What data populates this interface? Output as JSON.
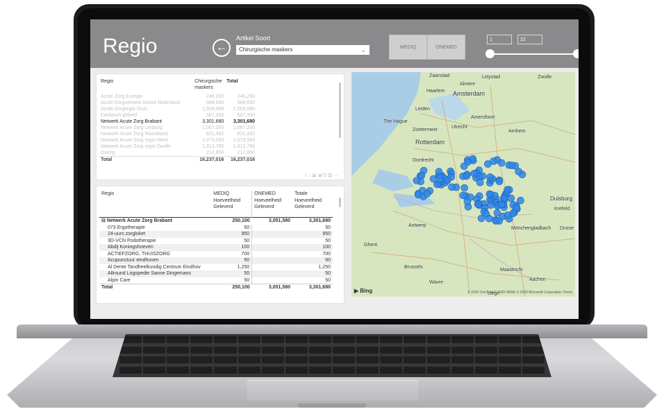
{
  "report": {
    "title": "Regio",
    "slicer_label": "Artikel Soort",
    "slicer_value": "Chirurgische maskers",
    "segments": [
      "MEDIQ",
      "ONEMED"
    ],
    "range_min": "1",
    "range_max": "22"
  },
  "table1": {
    "headers": [
      "Regio",
      "Chirurgische maskers",
      "Total"
    ],
    "rows": [
      {
        "name": "Acute Zorg Euregio",
        "a": "246,200",
        "b": "246,200",
        "state": "faded"
      },
      {
        "name": "Acute Zorgnetwerk Noord Nederland",
        "a": "968,650",
        "b": "968,650",
        "state": "faded"
      },
      {
        "name": "Acute Zorgregio Oost",
        "a": "1,559,080",
        "b": "1,559,080",
        "state": "faded"
      },
      {
        "name": "Caribisch gebied",
        "a": "507,350",
        "b": "507,350",
        "state": "faded"
      },
      {
        "name": "Netwerk Acute Zorg Brabant",
        "a": "3,301,680",
        "b": "3,301,680",
        "state": "hl"
      },
      {
        "name": "Netwerk Acute Zorg Limburg",
        "a": "1,067,200",
        "b": "1,067,200",
        "state": "faded"
      },
      {
        "name": "Netwerk Acute Zorg Noordwest",
        "a": "621,492",
        "b": "621,492",
        "state": "faded"
      },
      {
        "name": "Netwerk Acute Zorg regio West",
        "a": "1,073,583",
        "b": "1,073,583",
        "state": "faded"
      },
      {
        "name": "Netwerk Acute Zorg regio Zwolle",
        "a": "1,313,785",
        "b": "1,313,785",
        "state": "faded"
      },
      {
        "name": "Overig",
        "a": "212,850",
        "b": "212,850",
        "state": "faded"
      }
    ],
    "total_label": "Total",
    "total_a": "16,237,016",
    "total_b": "16,237,016"
  },
  "table2": {
    "headers": [
      "Regio",
      "MEDIQ Hoeveelheid Geleverd",
      "ONEMED Hoeveelheid Geleverd",
      "Totale Hoeveelheid Geleverd"
    ],
    "group": {
      "name": "Netwerk Acute Zorg Brabant",
      "m": "250,100",
      "o": "3,051,580",
      "t": "3,301,680"
    },
    "rows": [
      {
        "name": "073 Ergotherapie",
        "m": "50",
        "o": "",
        "t": "50"
      },
      {
        "name": "24-uurs zorgloket",
        "m": "950",
        "o": "",
        "t": "950"
      },
      {
        "name": "3D-VCN Podotherapie",
        "m": "50",
        "o": "",
        "t": "50"
      },
      {
        "name": "Abdij Koningshoeven",
        "m": "100",
        "o": "",
        "t": "100"
      },
      {
        "name": "ACTIEFZORG, THUISZORG",
        "m": "700",
        "o": "",
        "t": "700"
      },
      {
        "name": "Acupunctuur eindhoven",
        "m": "50",
        "o": "",
        "t": "50"
      },
      {
        "name": "Al Dente Tandheelkundig Centrum Eindhov",
        "m": "1,250",
        "o": "",
        "t": "1,250"
      },
      {
        "name": "Allround Logopedie Sanne Dingemans",
        "m": "50",
        "o": "",
        "t": "50"
      },
      {
        "name": "Alpin Care",
        "m": "50",
        "o": "",
        "t": "50"
      }
    ],
    "total_label": "Total",
    "total_m": "250,100",
    "total_o": "3,051,580",
    "total_t": "3,301,680"
  },
  "map": {
    "cities": [
      "Zaanstad",
      "Lelystad",
      "Zwolle",
      "Almere",
      "Haarlem",
      "Amsterdam",
      "Leiden",
      "Amersfoort",
      "The Hague",
      "Zoetermeer",
      "Utrecht",
      "Arnhem",
      "Rotterdam",
      "Dordrecht",
      "Duisburg",
      "Krefeld",
      "Antwerp",
      "Mönchengladbach",
      "Dusse",
      "Ghent",
      "Brussels",
      "Maastricht",
      "Aachen",
      "Wavre",
      "Liège"
    ],
    "attribution": "© 2020 TomTom © 2020 HERE © 2020 Microsoft Corporation Terms",
    "provider": "Bing",
    "marker_color": "#2f86e8"
  }
}
